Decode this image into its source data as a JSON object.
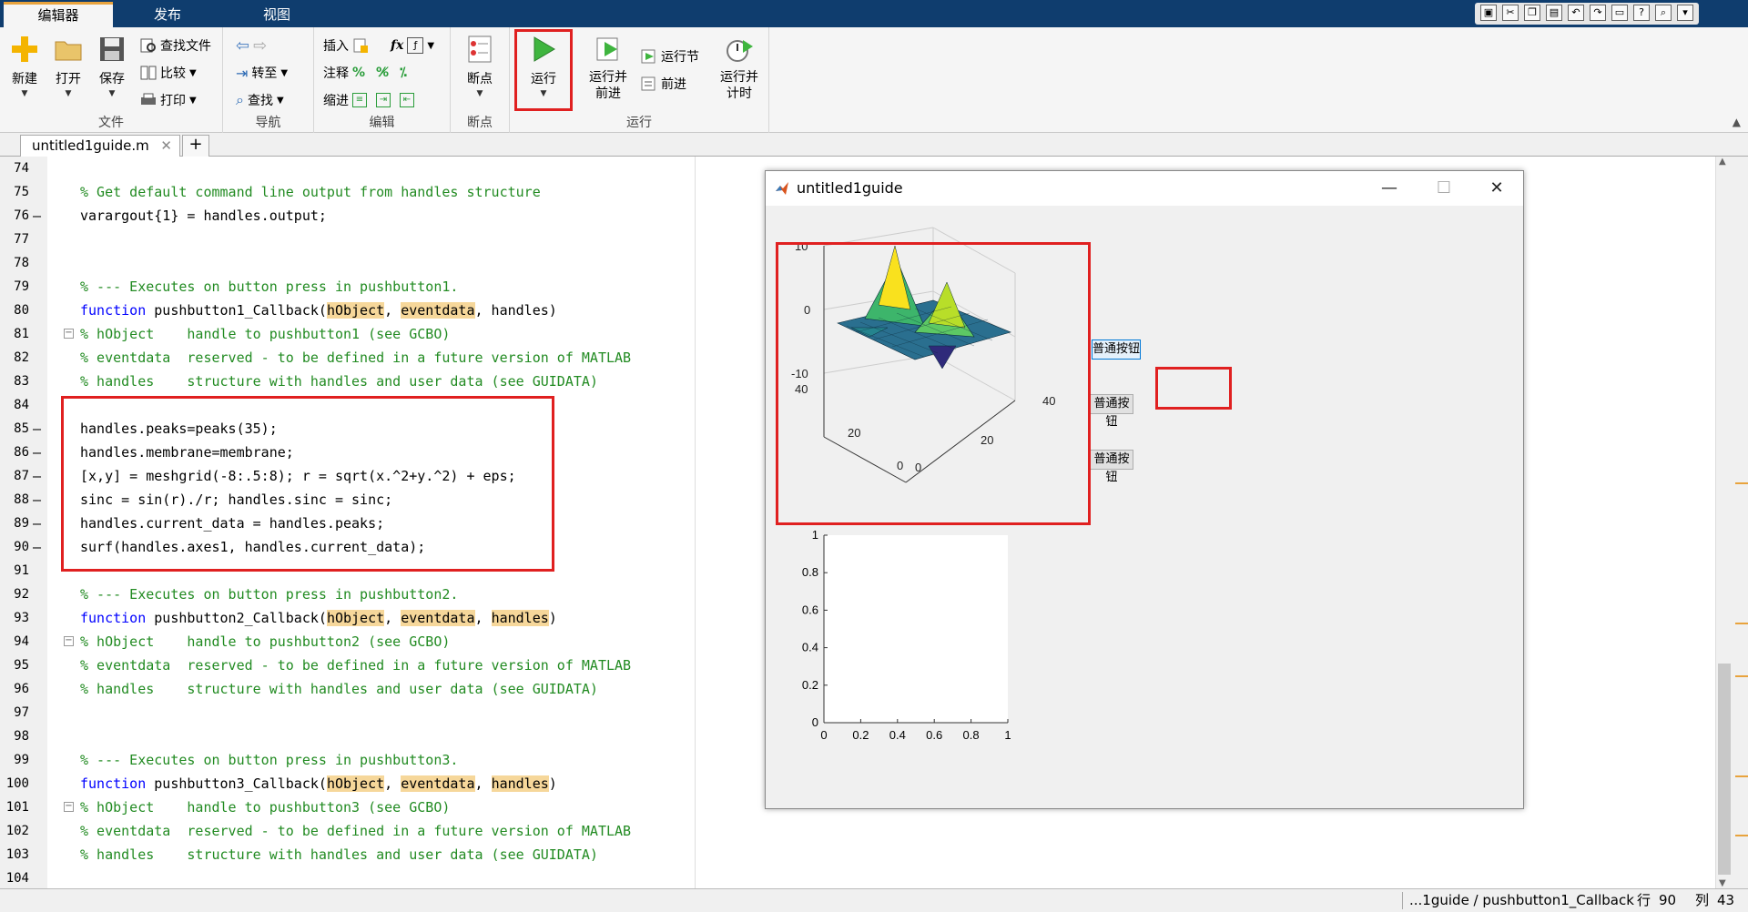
{
  "tabs": [
    "编辑器",
    "发布",
    "视图"
  ],
  "ribbon": {
    "file": {
      "group_label": "文件",
      "new_label": "新建",
      "open_label": "打开",
      "save_label": "保存",
      "find_files_label": "查找文件",
      "compare_label": "比较",
      "print_label": "打印"
    },
    "nav": {
      "group_label": "导航",
      "goto_label": "转至",
      "find_label": "查找"
    },
    "edit": {
      "group_label": "编辑",
      "insert_label": "插入",
      "comment_label": "注释",
      "indent_label": "缩进",
      "fx_label": "fx"
    },
    "breakpoints": {
      "group_label": "断点",
      "button_label": "断点"
    },
    "run": {
      "group_label": "运行",
      "run_label": "运行",
      "run_advance_label": "运行并\n前进",
      "run_section_label": "运行节",
      "advance_label": "前进",
      "run_time_label": "运行并\n计时"
    }
  },
  "document": {
    "tab_name": "untitled1guide.m",
    "close": "✕",
    "add": "+"
  },
  "code_lines": [
    {
      "n": "74",
      "dash": "",
      "parts": [
        {
          "t": "",
          "c": ""
        }
      ]
    },
    {
      "n": "75",
      "dash": "",
      "parts": [
        {
          "t": "% Get default command line output from handles structure",
          "c": "cmt"
        }
      ]
    },
    {
      "n": "76",
      "dash": "—",
      "parts": [
        {
          "t": "varargout{1} = handles.output;",
          "c": ""
        }
      ]
    },
    {
      "n": "77",
      "dash": "",
      "parts": [
        {
          "t": "",
          "c": ""
        }
      ]
    },
    {
      "n": "78",
      "dash": "",
      "parts": [
        {
          "t": "",
          "c": ""
        }
      ]
    },
    {
      "n": "79",
      "dash": "",
      "parts": [
        {
          "t": "% --- Executes on button press in pushbutton1.",
          "c": "cmt"
        }
      ]
    },
    {
      "n": "80",
      "dash": "",
      "parts": [
        {
          "t": "function",
          "c": "kw"
        },
        {
          "t": " pushbutton1_Callback(",
          "c": ""
        },
        {
          "t": "hObject",
          "c": "var"
        },
        {
          "t": ", ",
          "c": ""
        },
        {
          "t": "eventdata",
          "c": "var"
        },
        {
          "t": ", handles)",
          "c": ""
        }
      ]
    },
    {
      "n": "81",
      "dash": "",
      "parts": [
        {
          "t": "% hObject    handle to pushbutton1 (see GCBO)",
          "c": "cmt"
        }
      ]
    },
    {
      "n": "82",
      "dash": "",
      "parts": [
        {
          "t": "% eventdata  reserved - to be defined in a future version of MATLAB",
          "c": "cmt"
        }
      ]
    },
    {
      "n": "83",
      "dash": "",
      "parts": [
        {
          "t": "% handles    structure with handles and user data (see GUIDATA)",
          "c": "cmt"
        }
      ]
    },
    {
      "n": "84",
      "dash": "",
      "parts": [
        {
          "t": "",
          "c": ""
        }
      ]
    },
    {
      "n": "85",
      "dash": "—",
      "parts": [
        {
          "t": "handles.peaks=peaks(35);",
          "c": ""
        }
      ]
    },
    {
      "n": "86",
      "dash": "—",
      "parts": [
        {
          "t": "handles.membrane=membrane;",
          "c": ""
        }
      ]
    },
    {
      "n": "87",
      "dash": "—",
      "parts": [
        {
          "t": "[x,y] = meshgrid(-8:.5:8); r = sqrt(x.^2+y.^2) + eps;",
          "c": ""
        }
      ]
    },
    {
      "n": "88",
      "dash": "—",
      "parts": [
        {
          "t": "sinc = sin(r)./r; handles.sinc = sinc;",
          "c": ""
        }
      ]
    },
    {
      "n": "89",
      "dash": "—",
      "parts": [
        {
          "t": "handles.current_data = handles.peaks;",
          "c": ""
        }
      ]
    },
    {
      "n": "90",
      "dash": "—",
      "parts": [
        {
          "t": "surf(handles.axes1, handles.current_data);",
          "c": ""
        }
      ]
    },
    {
      "n": "91",
      "dash": "",
      "parts": [
        {
          "t": "",
          "c": ""
        }
      ]
    },
    {
      "n": "92",
      "dash": "",
      "parts": [
        {
          "t": "% --- Executes on button press in pushbutton2.",
          "c": "cmt"
        }
      ]
    },
    {
      "n": "93",
      "dash": "",
      "parts": [
        {
          "t": "function",
          "c": "kw"
        },
        {
          "t": " pushbutton2_Callback(",
          "c": ""
        },
        {
          "t": "hObject",
          "c": "var"
        },
        {
          "t": ", ",
          "c": ""
        },
        {
          "t": "eventdata",
          "c": "var"
        },
        {
          "t": ", ",
          "c": ""
        },
        {
          "t": "handles",
          "c": "var"
        },
        {
          "t": ")",
          "c": ""
        }
      ]
    },
    {
      "n": "94",
      "dash": "",
      "parts": [
        {
          "t": "% hObject    handle to pushbutton2 (see GCBO)",
          "c": "cmt"
        }
      ]
    },
    {
      "n": "95",
      "dash": "",
      "parts": [
        {
          "t": "% eventdata  reserved - to be defined in a future version of MATLAB",
          "c": "cmt"
        }
      ]
    },
    {
      "n": "96",
      "dash": "",
      "parts": [
        {
          "t": "% handles    structure with handles and user data (see GUIDATA)",
          "c": "cmt"
        }
      ]
    },
    {
      "n": "97",
      "dash": "",
      "parts": [
        {
          "t": "",
          "c": ""
        }
      ]
    },
    {
      "n": "98",
      "dash": "",
      "parts": [
        {
          "t": "",
          "c": ""
        }
      ]
    },
    {
      "n": "99",
      "dash": "",
      "parts": [
        {
          "t": "% --- Executes on button press in pushbutton3.",
          "c": "cmt"
        }
      ]
    },
    {
      "n": "100",
      "dash": "",
      "parts": [
        {
          "t": "function",
          "c": "kw"
        },
        {
          "t": " pushbutton3_Callback(",
          "c": ""
        },
        {
          "t": "hObject",
          "c": "var"
        },
        {
          "t": ", ",
          "c": ""
        },
        {
          "t": "eventdata",
          "c": "var"
        },
        {
          "t": ", ",
          "c": ""
        },
        {
          "t": "handles",
          "c": "var"
        },
        {
          "t": ")",
          "c": ""
        }
      ]
    },
    {
      "n": "101",
      "dash": "",
      "parts": [
        {
          "t": "% hObject    handle to pushbutton3 (see GCBO)",
          "c": "cmt"
        }
      ]
    },
    {
      "n": "102",
      "dash": "",
      "parts": [
        {
          "t": "% eventdata  reserved - to be defined in a future version of MATLAB",
          "c": "cmt"
        }
      ]
    },
    {
      "n": "103",
      "dash": "",
      "parts": [
        {
          "t": "% handles    structure with handles and user data (see GUIDATA)",
          "c": "cmt"
        }
      ]
    },
    {
      "n": "104",
      "dash": "",
      "parts": [
        {
          "t": "",
          "c": ""
        }
      ]
    }
  ],
  "figure": {
    "title": "untitled1guide",
    "minimize": "—",
    "maximize": "☐",
    "close": "✕",
    "buttons": [
      "普通按钮",
      "普通按钮",
      "普通按钮"
    ],
    "surf_axes": {
      "z_ticks": [
        "10",
        "0",
        "-10"
      ],
      "y_ticks": [
        "40",
        "20",
        "0"
      ],
      "x_ticks": [
        "0",
        "20",
        "40"
      ]
    },
    "axes2": {
      "y_ticks": [
        "1",
        "0.8",
        "0.6",
        "0.4",
        "0.2",
        "0"
      ],
      "x_ticks": [
        "0",
        "0.2",
        "0.4",
        "0.6",
        "0.8",
        "1"
      ]
    }
  },
  "statusbar": {
    "function_path": "...1guide / pushbutton1_Callback",
    "row_label": "行",
    "row_value": "90",
    "col_label": "列",
    "col_value": "43"
  },
  "colors": {
    "titlebar": "#0f3d6e",
    "highlight": "#e02020",
    "comment": "#228b22",
    "keyword": "#0000ff",
    "var_highlight": "#f6d79a"
  }
}
